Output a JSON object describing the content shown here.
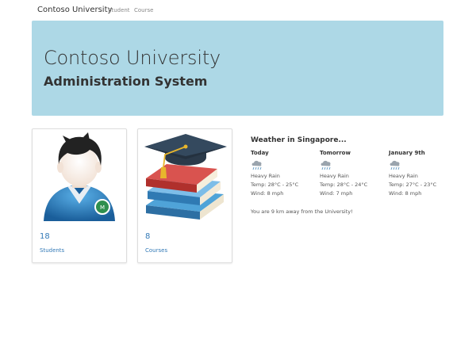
{
  "navbar": {
    "brand": "Contoso University",
    "links": [
      "Student",
      "Course"
    ]
  },
  "jumbotron": {
    "title": "Contoso University",
    "subtitle": "Administration System"
  },
  "cards": [
    {
      "count": "18",
      "label": "Students",
      "icon": "student-avatar-icon"
    },
    {
      "count": "8",
      "label": "Courses",
      "icon": "graduation-cap-books-icon"
    }
  ],
  "weather": {
    "title": "Weather in Singapore...",
    "days": [
      {
        "name": "Today",
        "condition": "Heavy Rain",
        "temp": "Temp: 28°C - 25°C",
        "wind": "Wind: 8 mph",
        "icon": "heavy-rain-icon"
      },
      {
        "name": "Tomorrow",
        "condition": "Heavy Rain",
        "temp": "Temp: 28°C - 24°C",
        "wind": "Wind: 7 mph",
        "icon": "heavy-rain-icon"
      },
      {
        "name": "January 9th",
        "condition": "Heavy Rain",
        "temp": "Temp: 27°C - 23°C",
        "wind": "Wind: 8 mph",
        "icon": "heavy-rain-icon"
      }
    ],
    "distance": "You are 9 km away from the University!"
  },
  "colors": {
    "jumbotron_bg": "#add8e6",
    "link": "#337ab7"
  }
}
